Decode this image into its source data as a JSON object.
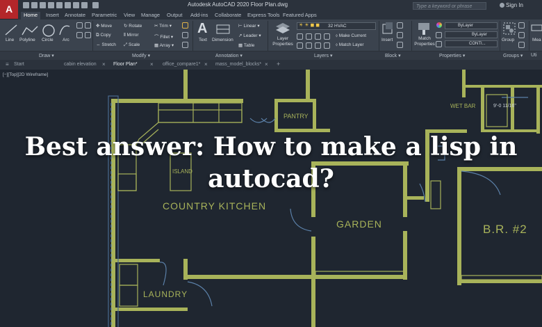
{
  "app": {
    "logo_letter": "A",
    "title": "Autodesk AutoCAD 2020    Floor Plan.dwg",
    "search_placeholder": "Type a keyword or phrase",
    "sign_in": "Sign In"
  },
  "menu": [
    "Home",
    "Insert",
    "Annotate",
    "Parametric",
    "View",
    "Manage",
    "Output",
    "Add-ins",
    "Collaborate",
    "Express Tools",
    "Featured Apps"
  ],
  "ribbon": {
    "draw": {
      "line": "Line",
      "polyline": "Polyline",
      "circle": "Circle",
      "arc": "Arc"
    },
    "modify": {
      "move": "Move",
      "rotate": "Rotate",
      "trim": "Trim",
      "copy": "Copy",
      "mirror": "Mirror",
      "fillet": "Fillet",
      "stretch": "Stretch",
      "scale": "Scale",
      "array": "Array"
    },
    "annotation": {
      "text": "Text",
      "dimension": "Dimension",
      "linear": "Linear",
      "leader": "Leader",
      "table": "Table"
    },
    "layers": {
      "layer_properties": "Layer Properties",
      "current_layer": "32 HVAC",
      "make_current": "Make Current",
      "match_layer": "Match Layer"
    },
    "block": {
      "insert": "Insert"
    },
    "properties": {
      "match_properties": "Match Properties",
      "bylayer1": "ByLayer",
      "bylayer2": "ByLayer",
      "continuous": "CONTI..."
    },
    "groups": {
      "group": "Group"
    },
    "utilities": {
      "measure": "Mea"
    },
    "panels": [
      "Draw",
      "Modify",
      "Annotation",
      "Layers",
      "Block",
      "Properties",
      "Groups",
      "Uti"
    ]
  },
  "doc_tabs": [
    {
      "label": "Start",
      "active": false
    },
    {
      "label": "cabin elevation",
      "active": false
    },
    {
      "label": "Floor Plan*",
      "active": true
    },
    {
      "label": "office_compare1*",
      "active": false
    },
    {
      "label": "mass_model_blocks*",
      "active": false
    }
  ],
  "viewport_label": "[−][Top][2D Wireframe]",
  "drawing": {
    "rooms": [
      "PANTRY",
      "ISLAND",
      "COUNTRY KITCHEN",
      "GARDEN",
      "LAUNDRY",
      "B.R. #2",
      "WET BAR"
    ],
    "dimension": "9'-0 11/16\"",
    "wall_color": "#a8b35a",
    "line_color": "#5b80a8"
  },
  "overlay": {
    "title": "Best answer: How to make a lisp in autocad?"
  },
  "colors": {
    "accent": "#b3262a",
    "background": "#1f2630"
  }
}
